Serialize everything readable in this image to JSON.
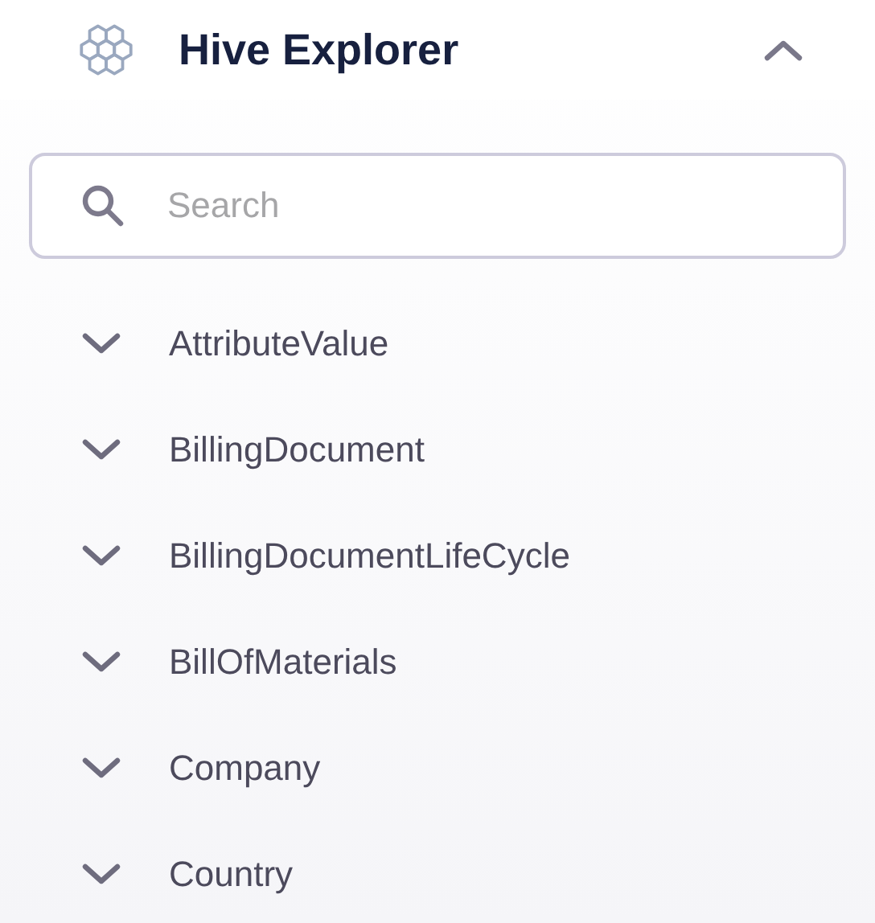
{
  "panel": {
    "title": "Hive Explorer",
    "expanded": true
  },
  "search": {
    "placeholder": "Search"
  },
  "items": [
    {
      "label": "AttributeValue",
      "expanded": false
    },
    {
      "label": "BillingDocument",
      "expanded": false
    },
    {
      "label": "BillingDocumentLifeCycle",
      "expanded": false
    },
    {
      "label": "BillOfMaterials",
      "expanded": false
    },
    {
      "label": "Company",
      "expanded": false
    },
    {
      "label": "Country",
      "expanded": false
    }
  ]
}
